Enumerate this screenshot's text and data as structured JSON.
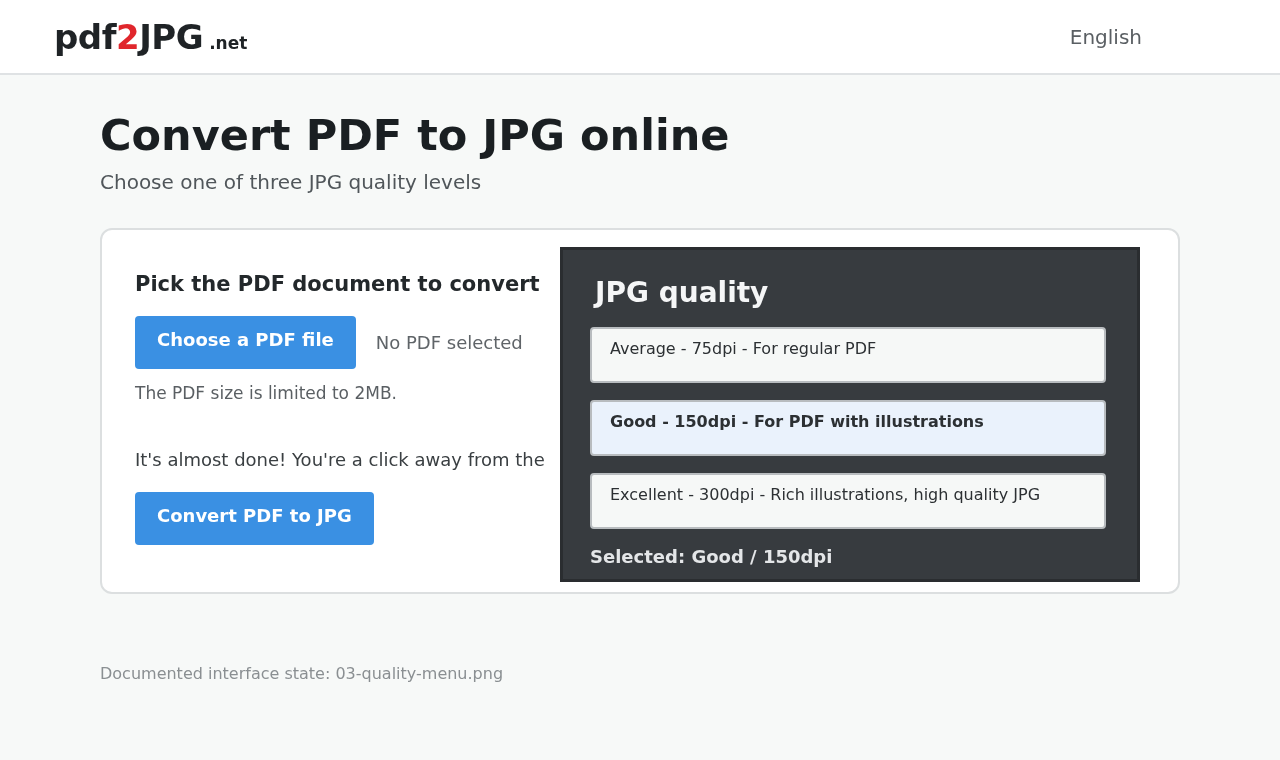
{
  "header": {
    "logo": {
      "before": "pdf",
      "accent": "2",
      "after": "JPG",
      "suffix": ".net"
    },
    "language": "English"
  },
  "title": "Convert PDF to JPG online",
  "subtitle": "Choose one of three JPG quality levels",
  "card": {
    "heading": "Pick the PDF document to convert",
    "choose_button": "Choose a PDF file",
    "file_status": "No PDF selected",
    "size_note": "The PDF size is limited to 2MB.",
    "ready_text": "It's almost done! You're a click away from the",
    "convert_button": "Convert PDF to JPG"
  },
  "quality_menu": {
    "title": "JPG quality",
    "options": [
      {
        "label": "Average - 75dpi - For regular PDF",
        "selected": false
      },
      {
        "label": "Good - 150dpi - For PDF with illustrations",
        "selected": true
      },
      {
        "label": "Excellent - 300dpi - Rich illustrations, high quality JPG",
        "selected": false
      }
    ],
    "selected_text": "Selected: Good / 150dpi"
  },
  "footer_note": "Documented interface state: 03-quality-menu.png"
}
